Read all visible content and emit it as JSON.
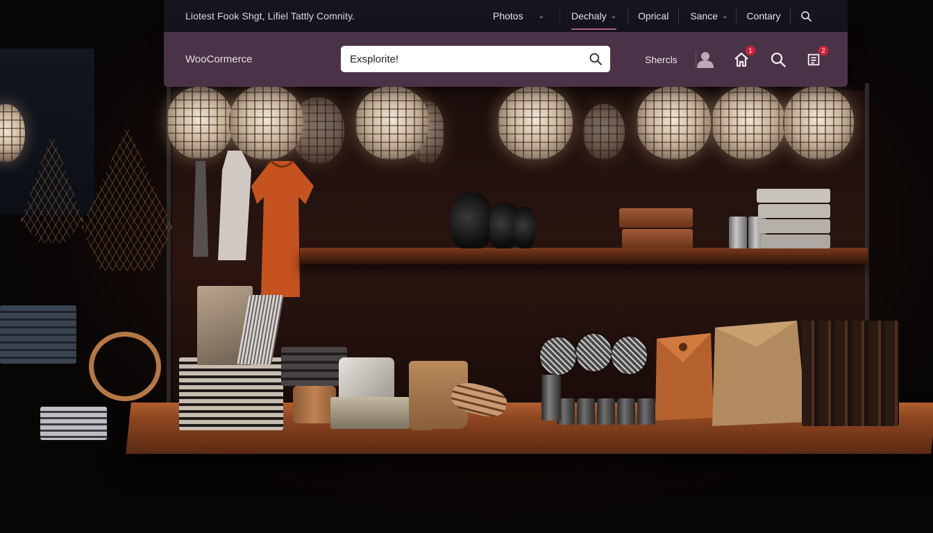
{
  "topbar": {
    "announcement": "Liotest Fook Shgt, Lifiel Tattly Comnity.",
    "nav": [
      {
        "label": "Photos",
        "has_chevron": true
      },
      {
        "label": "Dechaly",
        "has_chevron": true,
        "active": true
      },
      {
        "label": "Oprical",
        "has_chevron": false
      },
      {
        "label": "Sance",
        "has_chevron": true
      },
      {
        "label": "Contary",
        "has_chevron": false
      }
    ],
    "chevron_glyph": "⌄",
    "search_icon": "search-icon"
  },
  "header": {
    "brand": "WooCormerce",
    "search": {
      "value": "Exsplorite!",
      "icon": "search-icon"
    },
    "shortcut_label": "Shercls",
    "icons": {
      "account": {
        "icon": "user-icon"
      },
      "home": {
        "icon": "home-icon",
        "badge": "1"
      },
      "search": {
        "icon": "search-icon"
      },
      "cart": {
        "icon": "cart-icon",
        "badge": "2"
      }
    }
  },
  "colors": {
    "topbar_bg": "#15141f",
    "header_bg": "#4a3347",
    "badge": "#d1213b",
    "active_underline": "#b86b85"
  }
}
